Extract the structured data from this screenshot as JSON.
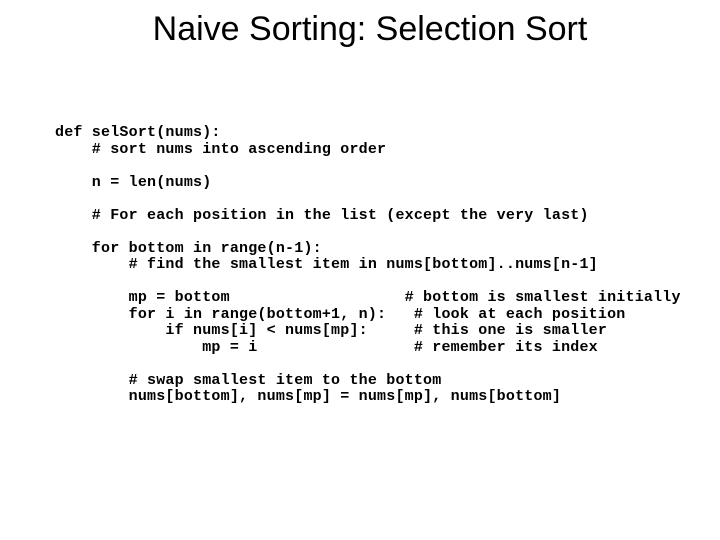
{
  "title": "Naive Sorting: Selection Sort",
  "code": {
    "l01": "def selSort(nums):",
    "l02": "    # sort nums into ascending order",
    "l03": "",
    "l04": "    n = len(nums)",
    "l05": "",
    "l06": "    # For each position in the list (except the very last)",
    "l07": "",
    "l08": "    for bottom in range(n-1):",
    "l09": "        # find the smallest item in nums[bottom]..nums[n-1]",
    "l10": "",
    "l11": "        mp = bottom                   # bottom is smallest initially",
    "l12": "        for i in range(bottom+1, n):   # look at each position",
    "l13": "            if nums[i] < nums[mp]:     # this one is smaller",
    "l14": "                mp = i                 # remember its index",
    "l15": "",
    "l16": "        # swap smallest item to the bottom",
    "l17": "        nums[bottom], nums[mp] = nums[mp], nums[bottom]"
  }
}
